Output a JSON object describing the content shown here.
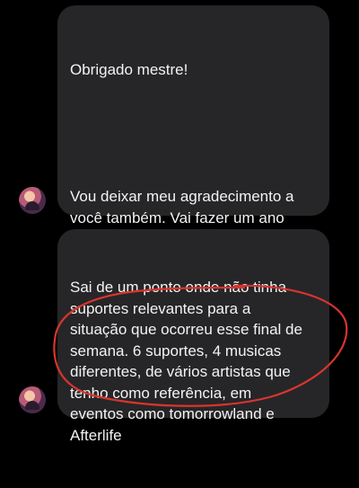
{
  "messages": [
    {
      "lines_1": "Obrigado mestre!",
      "lines_2": "Vou deixar meu agradecimento a\nvocê também. Vai fazer um ano\nagora em agosto que entrei na\ncomunidade e cara foi game\nchanging demais. Evolui demais\nnesse último ano e graças aos\nestudos na comunidade.",
      "emoji": "🙏🖤"
    },
    {
      "text": "Sai de um ponto onde não tinha\nsuportes relevantes para a\nsituação que ocorreu esse final de\nsemana. 6 suportes, 4 musicas\ndiferentes, de vários artistas que\ntenho como referência, em\neventos como tomorrowland e\nAfterlife"
    }
  ],
  "colors": {
    "bubble": "#262628",
    "background": "#000000",
    "annotation": "#d8352f"
  }
}
